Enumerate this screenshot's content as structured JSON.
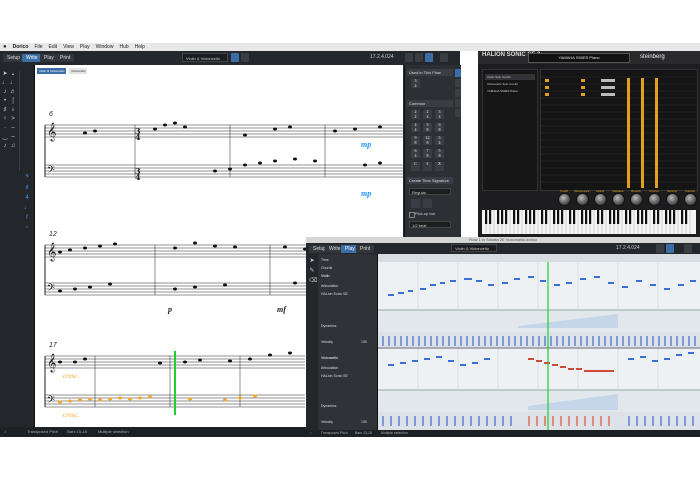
{
  "menubar": {
    "apple": "",
    "items": [
      "Dorico",
      "File",
      "Edit",
      "View",
      "Play",
      "Window",
      "Hub",
      "Help"
    ]
  },
  "dorico": {
    "modes": {
      "setup": "Setup",
      "write": "Write",
      "play": "Play",
      "print": "Print"
    },
    "window_title": "Flow 1 in Sonata 2E Violoncello.dorico",
    "layout_select": "Violin & Violoncello",
    "position": "17.2.4.024",
    "score_tabs": [
      "Violin & Violoncello",
      "Violoncello"
    ],
    "right_panel": {
      "used_in_flow": "Used in This Flow",
      "common": "Common",
      "create_time_sig": "Create Time Signature",
      "regular": "Regular",
      "pickup_checkbox": "Pick-up bar",
      "pickup_value": "1/2 beat"
    },
    "measure_numbers": [
      "6",
      "12",
      "17"
    ],
    "dynamics": {
      "mp1": "mp",
      "mp2": "mp",
      "p": "p",
      "mf": "mf",
      "cresc1": "cresc.",
      "cresc2": "cresc."
    },
    "status": {
      "transposed": "Transposed Pitch",
      "bars": "Bars 15-18",
      "selection": "Multiple selection"
    }
  },
  "halion": {
    "logo": "HALION SONIC SE 3",
    "patch": "YAMAHA S90ES Piano",
    "brand": "steinberg",
    "slots": [
      "Violin Solo Combi",
      "Violoncello Solo Combi",
      "YAMAHA S90ES Piano",
      "",
      "",
      "",
      "",
      "",
      "",
      "",
      "",
      "",
      "",
      "",
      "",
      ""
    ],
    "knob_labels": [
      "Cutoff",
      "Resonance",
      "Attack",
      "Release",
      "Reverb",
      "Chorus",
      "Velocity",
      "Volume"
    ]
  },
  "play_window": {
    "title": "Flow 1 in Sonata 2E Violoncello.dorico",
    "modes": {
      "setup": "Setup",
      "write": "Write",
      "play": "Play",
      "print": "Print"
    },
    "layout_select": "Violin & Violoncello",
    "position": "17.2.4.024",
    "tracks": {
      "time": "Time",
      "chords": "Chords",
      "violin": "Violin",
      "violoncello": "Violoncello",
      "articulation": "Articulation",
      "halion": "HALion Sonic SE",
      "dynamics": "Dynamics",
      "velocity": "Velocity",
      "velocity_val": "100"
    },
    "status": {
      "transposed": "Transposed Pitch",
      "bars": "Bars 15-18",
      "selection": "Multiple selection"
    }
  },
  "colors": {
    "accent": "#3a6ea5",
    "playhead": "#22cc33",
    "note_blue": "#3b6fd8",
    "note_red": "#d04a3a",
    "selected_orange": "#f5a623",
    "dynamic_blue": "#1e90ff"
  }
}
